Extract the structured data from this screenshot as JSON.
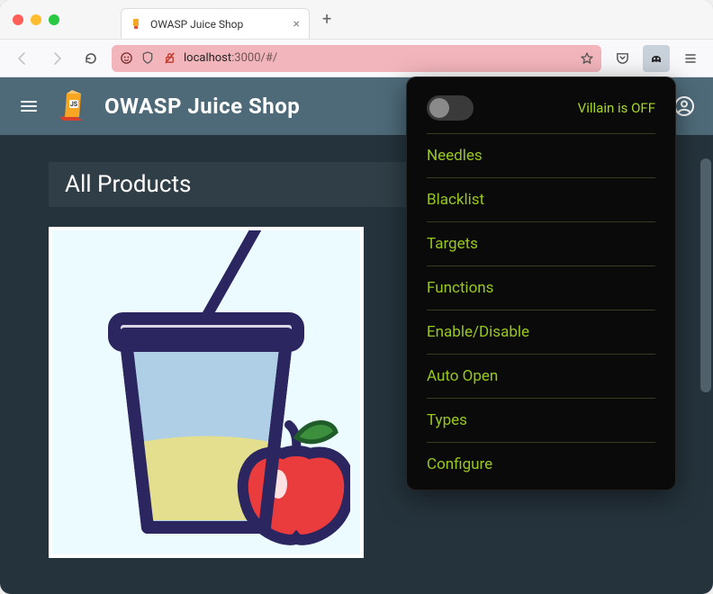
{
  "browser": {
    "tab_title": "OWASP Juice Shop",
    "url_host": "localhost",
    "url_port": ":3000",
    "url_path": "/#/"
  },
  "app": {
    "title": "OWASP Juice Shop",
    "heading": "All Products"
  },
  "ext": {
    "status": "Villain is OFF",
    "items": [
      "Needles",
      "Blacklist",
      "Targets",
      "Functions",
      "Enable/Disable",
      "Auto Open",
      "Types",
      "Configure"
    ]
  }
}
